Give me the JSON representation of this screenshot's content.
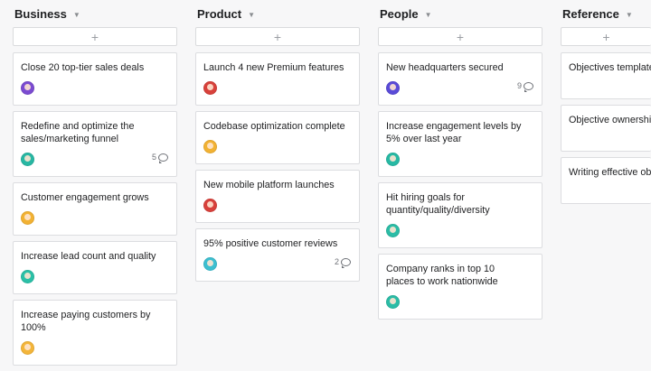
{
  "columns": [
    {
      "title": "Business",
      "add_label": "+",
      "cards": [
        {
          "title": "Close 20 top-tier sales deals",
          "avatar_color": "#7b4bd1"
        },
        {
          "title": "Redefine and optimize the sales/marketing funnel",
          "avatar_color": "#28b7a3",
          "comments": "5"
        },
        {
          "title": "Customer engagement grows",
          "avatar_color": "#f2b233"
        },
        {
          "title": "Increase lead count and quality",
          "avatar_color": "#2bc0a7"
        },
        {
          "title": "Increase paying customers by 100%",
          "avatar_color": "#f3b53a"
        }
      ]
    },
    {
      "title": "Product",
      "add_label": "+",
      "cards": [
        {
          "title": "Launch 4 new Premium features",
          "avatar_color": "#d8413b"
        },
        {
          "title": "Codebase optimization complete",
          "avatar_color": "#f2b233"
        },
        {
          "title": "New mobile platform launches",
          "avatar_color": "#d8413b"
        },
        {
          "title": "95% positive customer reviews",
          "avatar_color": "#3dbfd0",
          "comments": "2"
        }
      ]
    },
    {
      "title": "People",
      "add_label": "+",
      "cards": [
        {
          "title": "New headquarters secured",
          "avatar_color": "#5a4bd8",
          "comments": "9"
        },
        {
          "title": "Increase engagement levels by 5% over last year",
          "avatar_color": "#27b9a4"
        },
        {
          "title": "Hit hiring goals for quantity/quality/diversity",
          "avatar_color": "#2bbca6"
        },
        {
          "title": "Company ranks in top 10 places to work nationwide",
          "avatar_color": "#2bbca6"
        }
      ]
    },
    {
      "title": "Reference",
      "add_label": "+",
      "cards": [
        {
          "title": "Objectives template"
        },
        {
          "title": "Objective ownership g"
        },
        {
          "title": "Writing effective obj"
        }
      ]
    }
  ]
}
